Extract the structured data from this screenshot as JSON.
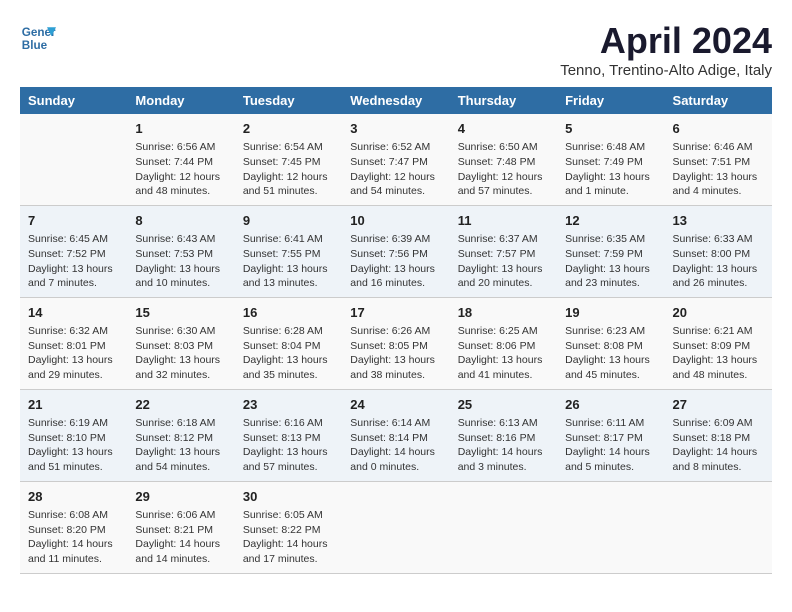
{
  "header": {
    "logo_line1": "General",
    "logo_line2": "Blue",
    "title": "April 2024",
    "subtitle": "Tenno, Trentino-Alto Adige, Italy"
  },
  "days_of_week": [
    "Sunday",
    "Monday",
    "Tuesday",
    "Wednesday",
    "Thursday",
    "Friday",
    "Saturday"
  ],
  "weeks": [
    {
      "days": [
        {
          "num": "",
          "content": ""
        },
        {
          "num": "1",
          "content": "Sunrise: 6:56 AM\nSunset: 7:44 PM\nDaylight: 12 hours and 48 minutes."
        },
        {
          "num": "2",
          "content": "Sunrise: 6:54 AM\nSunset: 7:45 PM\nDaylight: 12 hours and 51 minutes."
        },
        {
          "num": "3",
          "content": "Sunrise: 6:52 AM\nSunset: 7:47 PM\nDaylight: 12 hours and 54 minutes."
        },
        {
          "num": "4",
          "content": "Sunrise: 6:50 AM\nSunset: 7:48 PM\nDaylight: 12 hours and 57 minutes."
        },
        {
          "num": "5",
          "content": "Sunrise: 6:48 AM\nSunset: 7:49 PM\nDaylight: 13 hours and 1 minute."
        },
        {
          "num": "6",
          "content": "Sunrise: 6:46 AM\nSunset: 7:51 PM\nDaylight: 13 hours and 4 minutes."
        }
      ]
    },
    {
      "days": [
        {
          "num": "7",
          "content": "Sunrise: 6:45 AM\nSunset: 7:52 PM\nDaylight: 13 hours and 7 minutes."
        },
        {
          "num": "8",
          "content": "Sunrise: 6:43 AM\nSunset: 7:53 PM\nDaylight: 13 hours and 10 minutes."
        },
        {
          "num": "9",
          "content": "Sunrise: 6:41 AM\nSunset: 7:55 PM\nDaylight: 13 hours and 13 minutes."
        },
        {
          "num": "10",
          "content": "Sunrise: 6:39 AM\nSunset: 7:56 PM\nDaylight: 13 hours and 16 minutes."
        },
        {
          "num": "11",
          "content": "Sunrise: 6:37 AM\nSunset: 7:57 PM\nDaylight: 13 hours and 20 minutes."
        },
        {
          "num": "12",
          "content": "Sunrise: 6:35 AM\nSunset: 7:59 PM\nDaylight: 13 hours and 23 minutes."
        },
        {
          "num": "13",
          "content": "Sunrise: 6:33 AM\nSunset: 8:00 PM\nDaylight: 13 hours and 26 minutes."
        }
      ]
    },
    {
      "days": [
        {
          "num": "14",
          "content": "Sunrise: 6:32 AM\nSunset: 8:01 PM\nDaylight: 13 hours and 29 minutes."
        },
        {
          "num": "15",
          "content": "Sunrise: 6:30 AM\nSunset: 8:03 PM\nDaylight: 13 hours and 32 minutes."
        },
        {
          "num": "16",
          "content": "Sunrise: 6:28 AM\nSunset: 8:04 PM\nDaylight: 13 hours and 35 minutes."
        },
        {
          "num": "17",
          "content": "Sunrise: 6:26 AM\nSunset: 8:05 PM\nDaylight: 13 hours and 38 minutes."
        },
        {
          "num": "18",
          "content": "Sunrise: 6:25 AM\nSunset: 8:06 PM\nDaylight: 13 hours and 41 minutes."
        },
        {
          "num": "19",
          "content": "Sunrise: 6:23 AM\nSunset: 8:08 PM\nDaylight: 13 hours and 45 minutes."
        },
        {
          "num": "20",
          "content": "Sunrise: 6:21 AM\nSunset: 8:09 PM\nDaylight: 13 hours and 48 minutes."
        }
      ]
    },
    {
      "days": [
        {
          "num": "21",
          "content": "Sunrise: 6:19 AM\nSunset: 8:10 PM\nDaylight: 13 hours and 51 minutes."
        },
        {
          "num": "22",
          "content": "Sunrise: 6:18 AM\nSunset: 8:12 PM\nDaylight: 13 hours and 54 minutes."
        },
        {
          "num": "23",
          "content": "Sunrise: 6:16 AM\nSunset: 8:13 PM\nDaylight: 13 hours and 57 minutes."
        },
        {
          "num": "24",
          "content": "Sunrise: 6:14 AM\nSunset: 8:14 PM\nDaylight: 14 hours and 0 minutes."
        },
        {
          "num": "25",
          "content": "Sunrise: 6:13 AM\nSunset: 8:16 PM\nDaylight: 14 hours and 3 minutes."
        },
        {
          "num": "26",
          "content": "Sunrise: 6:11 AM\nSunset: 8:17 PM\nDaylight: 14 hours and 5 minutes."
        },
        {
          "num": "27",
          "content": "Sunrise: 6:09 AM\nSunset: 8:18 PM\nDaylight: 14 hours and 8 minutes."
        }
      ]
    },
    {
      "days": [
        {
          "num": "28",
          "content": "Sunrise: 6:08 AM\nSunset: 8:20 PM\nDaylight: 14 hours and 11 minutes."
        },
        {
          "num": "29",
          "content": "Sunrise: 6:06 AM\nSunset: 8:21 PM\nDaylight: 14 hours and 14 minutes."
        },
        {
          "num": "30",
          "content": "Sunrise: 6:05 AM\nSunset: 8:22 PM\nDaylight: 14 hours and 17 minutes."
        },
        {
          "num": "",
          "content": ""
        },
        {
          "num": "",
          "content": ""
        },
        {
          "num": "",
          "content": ""
        },
        {
          "num": "",
          "content": ""
        }
      ]
    }
  ]
}
